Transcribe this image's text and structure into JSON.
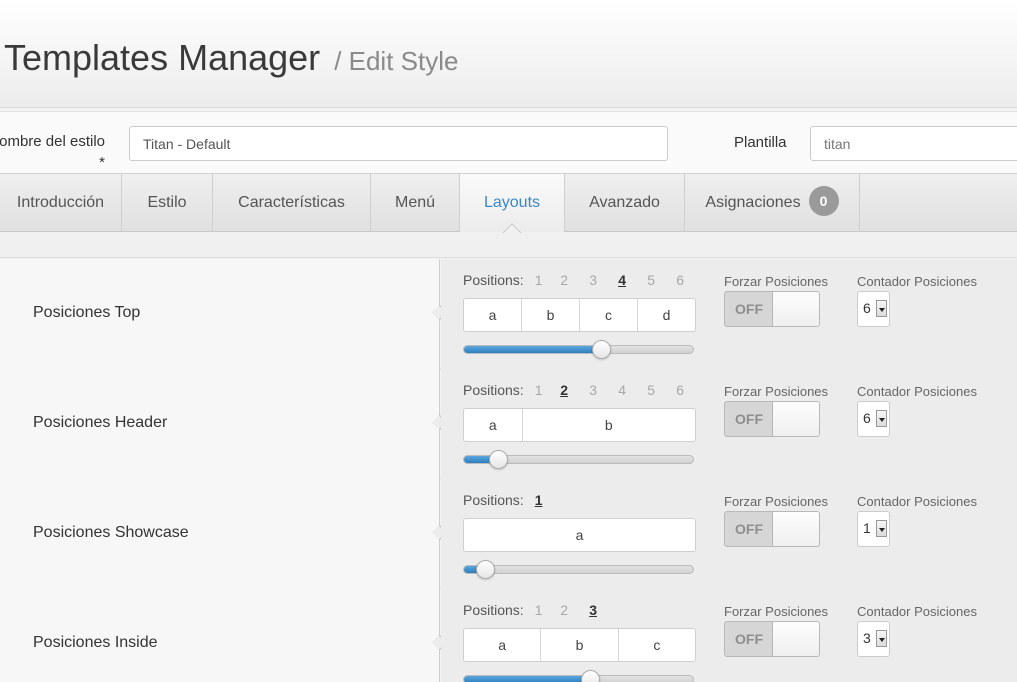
{
  "header": {
    "title": "Templates Manager",
    "subtitle": "/ Edit Style"
  },
  "form": {
    "style_name_label": "Nombre del estilo *",
    "style_name_value": "Titan - Default",
    "template_label": "Plantilla",
    "template_value": "titan"
  },
  "tabs": [
    {
      "label": "Introducción"
    },
    {
      "label": "Estilo"
    },
    {
      "label": "Características"
    },
    {
      "label": "Menú"
    },
    {
      "label": "Layouts",
      "active": true
    },
    {
      "label": "Avanzado"
    },
    {
      "label": "Asignaciones",
      "badge": "0"
    }
  ],
  "common": {
    "positions_label": "Positions:",
    "force_label": "Forzar Posiciones",
    "toggle_off": "OFF",
    "count_label": "Contador Posiciones"
  },
  "rows": [
    {
      "name": "Posiciones Top",
      "numbers": [
        "1",
        "2",
        "3",
        "4",
        "5",
        "6"
      ],
      "selected": "4",
      "boxes": [
        "a",
        "b",
        "c",
        "d"
      ],
      "slider_fraction": 0.6,
      "count": "6"
    },
    {
      "name": "Posiciones Header",
      "numbers": [
        "1",
        "2",
        "3",
        "4",
        "5",
        "6"
      ],
      "selected": "2",
      "boxes": [
        "a",
        "b"
      ],
      "box_weights": [
        1,
        3
      ],
      "slider_fraction": 0.15,
      "count": "6"
    },
    {
      "name": "Posiciones Showcase",
      "numbers": [
        "1"
      ],
      "selected": "1",
      "boxes": [
        "a"
      ],
      "slider_fraction": 0.09,
      "count": "1"
    },
    {
      "name": "Posiciones Inside",
      "numbers": [
        "1",
        "2",
        "3"
      ],
      "selected": "3",
      "boxes": [
        "a",
        "b",
        "c"
      ],
      "slider_fraction": 0.55,
      "count": "3"
    }
  ],
  "colors": {
    "accent": "#3a87c8",
    "slider_fill": "#2d7fbe",
    "badge": "#9a9a9a"
  }
}
